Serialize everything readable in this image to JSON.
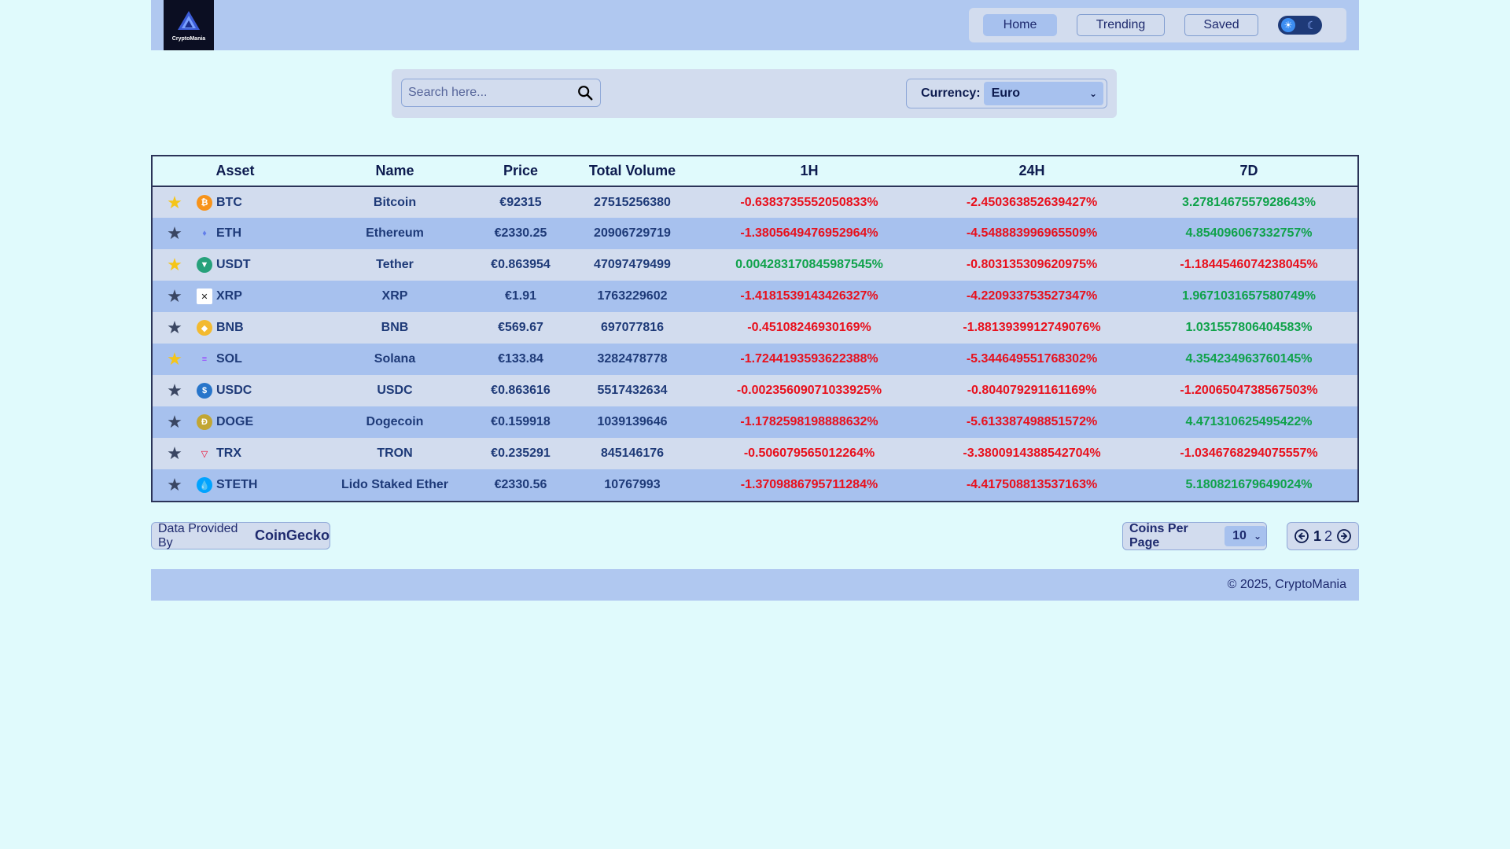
{
  "app": {
    "logo_text": "CryptoMania"
  },
  "nav": {
    "items": [
      {
        "label": "Home",
        "active": true
      },
      {
        "label": "Trending",
        "active": false
      },
      {
        "label": "Saved",
        "active": false
      }
    ],
    "theme_toggle": {
      "sun_icon": "sun-icon",
      "moon_icon": "moon-icon"
    }
  },
  "toolbar": {
    "search_placeholder": "Search here...",
    "currency_label": "Currency:",
    "currency_value": "Euro"
  },
  "table": {
    "headers": [
      "Asset",
      "Name",
      "Price",
      "Total Volume",
      "1H",
      "24H",
      "7D"
    ],
    "rows": [
      {
        "saved": true,
        "symbol": "BTC",
        "icon": "bitcoin-icon",
        "icon_color": "#f7931a",
        "name": "Bitcoin",
        "price": "€92315",
        "volume": "27515256380",
        "h1": "-0.6383735552050833%",
        "h24": "-2.450363852639427%",
        "d7": "3.2781467557928643%"
      },
      {
        "saved": false,
        "symbol": "ETH",
        "icon": "ethereum-icon",
        "icon_color": "#627eea",
        "name": "Ethereum",
        "price": "€2330.25",
        "volume": "20906729719",
        "h1": "-1.3805649476952964%",
        "h24": "-4.548883996965509%",
        "d7": "4.854096067332757%"
      },
      {
        "saved": true,
        "symbol": "USDT",
        "icon": "tether-icon",
        "icon_color": "#26a17b",
        "name": "Tether",
        "price": "€0.863954",
        "volume": "47097479499",
        "h1": "0.004283170845987545%",
        "h24": "-0.803135309620975%",
        "d7": "-1.1844546074238045%"
      },
      {
        "saved": false,
        "symbol": "XRP",
        "icon": "xrp-icon",
        "icon_color": "#ffffff",
        "name": "XRP",
        "price": "€1.91",
        "volume": "1763229602",
        "h1": "-1.4181539143426327%",
        "h24": "-4.220933753527347%",
        "d7": "1.9671031657580749%"
      },
      {
        "saved": false,
        "symbol": "BNB",
        "icon": "bnb-icon",
        "icon_color": "#f3ba2f",
        "name": "BNB",
        "price": "€569.67",
        "volume": "697077816",
        "h1": "-0.45108246930169%",
        "h24": "-1.8813939912749076%",
        "d7": "1.031557806404583%"
      },
      {
        "saved": true,
        "symbol": "SOL",
        "icon": "solana-icon",
        "icon_color": "#9945ff",
        "name": "Solana",
        "price": "€133.84",
        "volume": "3282478778",
        "h1": "-1.7244193593622388%",
        "h24": "-5.344649551768302%",
        "d7": "4.354234963760145%"
      },
      {
        "saved": false,
        "symbol": "USDC",
        "icon": "usdc-icon",
        "icon_color": "#2775ca",
        "name": "USDC",
        "price": "€0.863616",
        "volume": "5517432634",
        "h1": "-0.00235609071033925%",
        "h24": "-0.804079291161169%",
        "d7": "-1.2006504738567503%"
      },
      {
        "saved": false,
        "symbol": "DOGE",
        "icon": "dogecoin-icon",
        "icon_color": "#c2a633",
        "name": "Dogecoin",
        "price": "€0.159918",
        "volume": "1039139646",
        "h1": "-1.1782598198888632%",
        "h24": "-5.613387498851572%",
        "d7": "4.471310625495422%"
      },
      {
        "saved": false,
        "symbol": "TRX",
        "icon": "tron-icon",
        "icon_color": "#ef0027",
        "name": "TRON",
        "price": "€0.235291",
        "volume": "845146176",
        "h1": "-0.506079565012264%",
        "h24": "-3.3800914388542704%",
        "d7": "-1.0346768294075557%"
      },
      {
        "saved": false,
        "symbol": "STETH",
        "icon": "steth-icon",
        "icon_color": "#00a3ff",
        "name": "Lido Staked Ether",
        "price": "€2330.56",
        "volume": "10767993",
        "h1": "-1.3709886795711284%",
        "h24": "-4.417508813537163%",
        "d7": "5.180821679649024%"
      }
    ]
  },
  "colors": {
    "negative": "#e8101c",
    "positive": "#0fa24a",
    "star_saved": "#f5c518",
    "star_unsaved": "#3a4662"
  },
  "footer": {
    "provider_prefix": "Data Provided By",
    "provider_brand": "CoinGecko",
    "per_page_label": "Coins Per Page",
    "per_page_value": "10",
    "pages": [
      "1",
      "2"
    ],
    "current_page": "1",
    "copyright": "© 2025, CryptoMania"
  }
}
